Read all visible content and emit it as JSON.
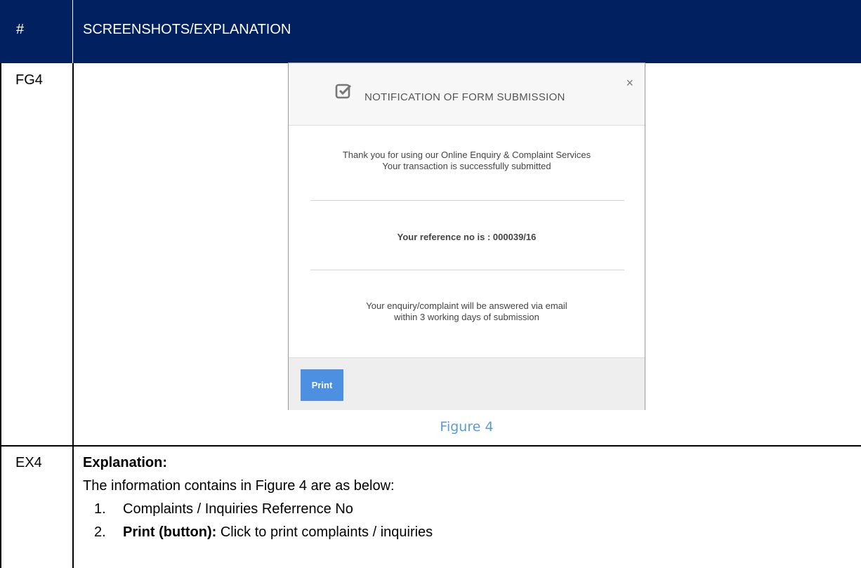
{
  "header": {
    "hash": "#",
    "title": "SCREENSHOTS/EXPLANATION"
  },
  "rows": {
    "fg_label": "FG4",
    "ex_label": "EX4"
  },
  "dialog": {
    "title": "NOTIFICATION OF FORM SUBMISSION",
    "close_label": "×",
    "thank_line1": "Thank you for using our Online Enquiry & Complaint Services",
    "thank_line2": "Your transaction is successfully submitted",
    "reference": "Your reference no is : 000039/16",
    "answer_line1": "Your enquiry/complaint will be answered via email",
    "answer_line2": "within 3 working days of submission",
    "print_label": "Print",
    "icon": "check-square-icon"
  },
  "figure_caption": "Figure 4",
  "explanation": {
    "title": "Explanation:",
    "intro": "The information contains in Figure 4 are as below:",
    "items": [
      {
        "num": "1.",
        "bold": "",
        "text": "Complaints / Inquiries Referrence No"
      },
      {
        "num": "2.",
        "bold": "Print (button):",
        "text": " Click to print complaints / inquiries"
      }
    ]
  },
  "colors": {
    "header_bg": "#002060",
    "caption": "#5b9bd5",
    "print_button": "#4d8fe0"
  }
}
